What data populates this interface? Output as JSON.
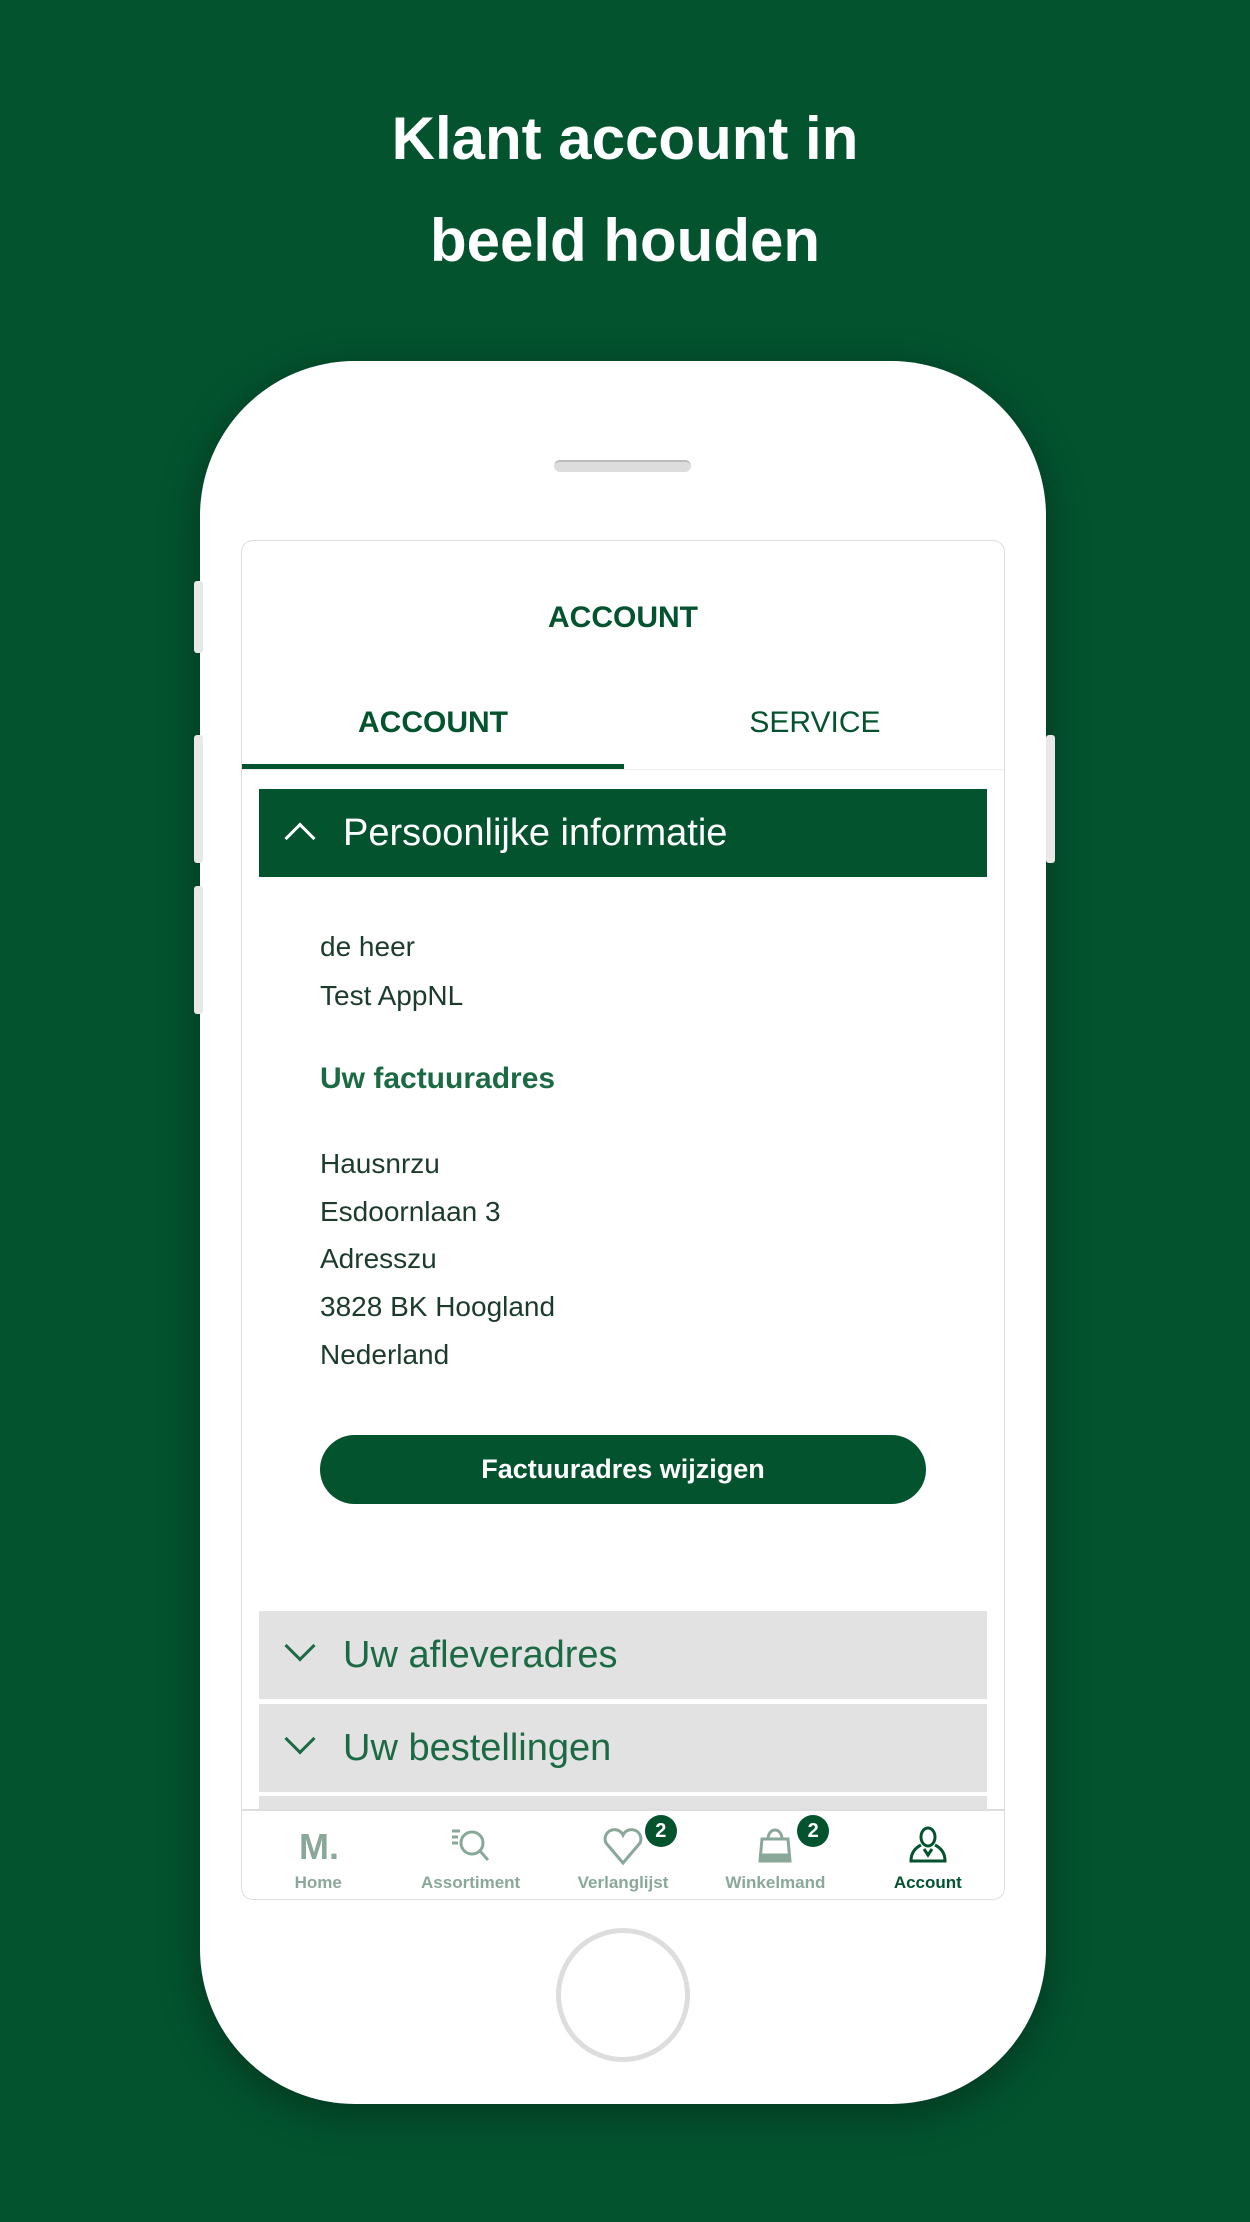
{
  "headline": {
    "line1": "Klant account in",
    "line2": "beeld houden"
  },
  "page_title": "ACCOUNT",
  "tabs": [
    {
      "label": "ACCOUNT",
      "active": true
    },
    {
      "label": "SERVICE",
      "active": false
    }
  ],
  "personal": {
    "header": "Persoonlijke informatie",
    "salutation": "de heer",
    "name": "Test AppNL"
  },
  "billing": {
    "title": "Uw factuuradres",
    "lines": [
      "Hausnrzu",
      "Esdoornlaan 3",
      "Adresszu",
      "3828 BK Hoogland",
      "Nederland"
    ],
    "button": "Factuuradres wijzigen"
  },
  "sections": [
    "Uw afleveradres",
    "Uw bestellingen"
  ],
  "nav": [
    {
      "label": "Home",
      "icon": "m-logo-icon"
    },
    {
      "label": "Assortiment",
      "icon": "search-list-icon"
    },
    {
      "label": "Verlanglijst",
      "icon": "heart-icon",
      "badge": "2"
    },
    {
      "label": "Winkelmand",
      "icon": "bag-icon",
      "badge": "2"
    },
    {
      "label": "Account",
      "icon": "user-icon",
      "active": true
    }
  ],
  "colors": {
    "brand": "#03532f",
    "background": "#03532f"
  }
}
